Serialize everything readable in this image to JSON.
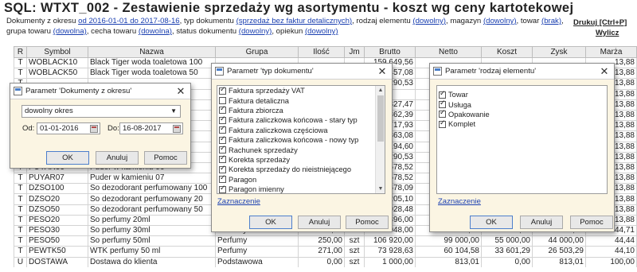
{
  "header": {
    "title": "SQL: WTXT_002 - Zestawienie sprzedaży wg asortymentu - koszt wg ceny kartotekowej",
    "params": [
      {
        "text": "Dokumenty z okresu ",
        "link": false
      },
      {
        "text": "od 2016-01-01 do 2017-08-16",
        "link": true
      },
      {
        "text": ", typ dokumentu ",
        "link": false
      },
      {
        "text": "(sprzedaż bez faktur detalicznych)",
        "link": true
      },
      {
        "text": ", rodzaj elementu ",
        "link": false
      },
      {
        "text": "(dowolny)",
        "link": true
      },
      {
        "text": ", magazyn ",
        "link": false
      },
      {
        "text": "(dowolny)",
        "link": true
      },
      {
        "text": ", towar ",
        "link": false
      },
      {
        "text": "(brak)",
        "link": true
      },
      {
        "text": ", grupa towaru ",
        "link": false
      },
      {
        "text": "(dowolna)",
        "link": true
      },
      {
        "text": ", cecha towaru ",
        "link": false
      },
      {
        "text": "(dowolna)",
        "link": true
      },
      {
        "text": ", status dokumentu ",
        "link": false
      },
      {
        "text": "(dowolny)",
        "link": true
      },
      {
        "text": ", opiekun ",
        "link": false
      },
      {
        "text": "(dowolny)",
        "link": true
      }
    ],
    "print_label": "Drukuj [Ctrl+P]",
    "close_label": "Wylicz"
  },
  "table": {
    "columns": [
      "R",
      "Symbol",
      "Nazwa",
      "Grupa",
      "Ilość",
      "Jm",
      "Brutto",
      "Netto",
      "Koszt",
      "Zysk",
      "Marża"
    ],
    "rows": [
      [
        "T",
        "WOBLACK10",
        "Black Tiger woda toaletowa 100",
        "",
        "",
        "",
        "159 649,56",
        "",
        "",
        "",
        "13,88"
      ],
      [
        "T",
        "WOBLACK50",
        "Black Tiger woda toaletowa 50",
        "",
        "",
        "",
        "457,08",
        "",
        "",
        "",
        "13,88"
      ],
      [
        "T",
        "",
        "",
        "",
        "",
        "",
        "290,53",
        "",
        "",
        "",
        "13,88"
      ],
      [
        "",
        "",
        "",
        "",
        "",
        "",
        "",
        "",
        "",
        "",
        "13,88"
      ],
      [
        "",
        "",
        "",
        "",
        "",
        "",
        "827,47",
        "",
        "",
        "",
        "13,88"
      ],
      [
        "",
        "",
        "",
        "",
        "",
        "",
        "862,39",
        "",
        "",
        "",
        "13,88"
      ],
      [
        "",
        "",
        "Puder w kamieniu 15m",
        "",
        "",
        "",
        "717,93",
        "",
        "",
        "",
        "13,88"
      ],
      [
        "",
        "",
        "",
        "",
        "",
        "",
        "863,08",
        "",
        "",
        "",
        "13,88"
      ],
      [
        "",
        "",
        "",
        "",
        "",
        "",
        "194,60",
        "",
        "",
        "",
        "13,88"
      ],
      [
        "",
        "",
        "",
        "",
        "",
        "",
        "290,53",
        "",
        "",
        "",
        "13,88"
      ],
      [
        "T",
        "PUYAR06",
        "Puder w kamieniu 06",
        "",
        "",
        "",
        "578,52",
        "",
        "",
        "",
        "13,88"
      ],
      [
        "T",
        "PUYAR07",
        "Puder w kamieniu 07",
        "",
        "",
        "",
        "578,52",
        "",
        "",
        "",
        "13,88"
      ],
      [
        "T",
        "DZSO100",
        "So dezodorant perfumowany 100",
        "",
        "",
        "",
        "678,09",
        "",
        "",
        "",
        "13,88"
      ],
      [
        "T",
        "DZSO20",
        "So dezodorant perfumowany 20",
        "",
        "",
        "",
        "205,10",
        "",
        "",
        "",
        "13,88"
      ],
      [
        "T",
        "DZSO50",
        "So dezodorant perfumowany 50",
        "",
        "",
        "",
        "028,48",
        "",
        "",
        "",
        "13,88"
      ],
      [
        "T",
        "PESO20",
        "So perfumy 20ml",
        "",
        "",
        "",
        "396,00",
        "",
        "",
        "",
        "13,88"
      ],
      [
        "T",
        "PESO30",
        "So perfumy 30ml",
        "Perfumy",
        "94,00",
        "szt",
        "33 048,00",
        "30 600,00",
        "16 920,00",
        "13 680,00",
        "44,71"
      ],
      [
        "T",
        "PESO50",
        "So perfumy 50ml",
        "Perfumy",
        "250,00",
        "szt",
        "106 920,00",
        "99 000,00",
        "55 000,00",
        "44 000,00",
        "44,44"
      ],
      [
        "T",
        "PEWTK50",
        "WTK perfumy 50 ml",
        "Perfumy",
        "271,00",
        "szt",
        "73 928,63",
        "60 104,58",
        "33 601,29",
        "26 503,29",
        "44,10"
      ],
      [
        "U",
        "DOSTAWA",
        "Dostawa do klienta",
        "Podstawowa",
        "0,00",
        "szt",
        "1 000,00",
        "813,01",
        "0,00",
        "813,01",
        "100,00"
      ]
    ]
  },
  "dialog_okres": {
    "title": "Parametr 'Dokumenty z okresu'",
    "period_select": "dowolny okres",
    "from_label": "Od:",
    "from_value": "01-01-2016",
    "to_label": "Do:",
    "to_value": "16-08-2017",
    "ok": "OK",
    "cancel": "Anuluj",
    "help": "Pomoc"
  },
  "dialog_typ": {
    "title": "Parametr 'typ dokumentu'",
    "items": [
      {
        "label": "Faktura sprzedaży VAT",
        "checked": true
      },
      {
        "label": "Faktura detaliczna",
        "checked": false
      },
      {
        "label": "Faktura zbiorcza",
        "checked": true
      },
      {
        "label": "Faktura zaliczkowa końcowa - stary typ",
        "checked": true
      },
      {
        "label": "Faktura zaliczkowa częściowa",
        "checked": true
      },
      {
        "label": "Faktura zaliczkowa końcowa - nowy typ",
        "checked": true
      },
      {
        "label": "Rachunek sprzedaży",
        "checked": true
      },
      {
        "label": "Korekta sprzedaży",
        "checked": true
      },
      {
        "label": "Korekta sprzedaży do nieistniejącego",
        "checked": true
      },
      {
        "label": "Paragon",
        "checked": true
      },
      {
        "label": "Paragon imienny",
        "checked": true
      }
    ],
    "select_link": "Zaznaczenie",
    "ok": "OK",
    "cancel": "Anuluj",
    "help": "Pomoc"
  },
  "dialog_rodzaj": {
    "title": "Parametr 'rodzaj elementu'",
    "items": [
      {
        "label": "Towar",
        "checked": true
      },
      {
        "label": "Usługa",
        "checked": true
      },
      {
        "label": "Opakowanie",
        "checked": true
      },
      {
        "label": "Komplet",
        "checked": true
      }
    ],
    "select_link": "Zaznaczenie",
    "ok": "OK",
    "cancel": "Anuluj",
    "help": "Pomoc"
  }
}
